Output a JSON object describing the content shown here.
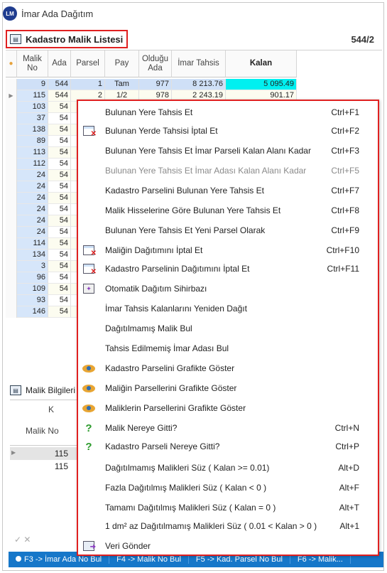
{
  "window": {
    "title": "İmar Ada Dağıtım",
    "logo_text": "LM"
  },
  "panel": {
    "title": "Kadastro Malik Listesi",
    "count": "544/2"
  },
  "grid": {
    "columns": [
      "Malik No",
      "Ada",
      "Parsel",
      "Pay",
      "Olduğu Ada",
      "İmar Tahsis",
      "Kalan"
    ],
    "first_row": {
      "malik_no": "9",
      "ada": "544",
      "parsel": "1",
      "pay": "Tam",
      "oldugu_ada": "977",
      "imar_tahsis": "8 213.76",
      "kalan": "5 095.49"
    },
    "second_row": {
      "malik_no": "115",
      "ada": "544",
      "parsel": "2",
      "pay": "1/2",
      "oldugu_ada": "978",
      "imar_tahsis": "2 243.19",
      "kalan": "901.17"
    },
    "malik_nos": [
      "103",
      "37",
      "138",
      "89",
      "113",
      "112",
      "24",
      "24",
      "24",
      "24",
      "24",
      "24",
      "114",
      "134",
      "3",
      "96",
      "109",
      "93",
      "146"
    ],
    "ada_partial": "54"
  },
  "lower_panel": {
    "title": "Malik Bilgileri",
    "col_k": "K",
    "col_malik_no": "Malik No",
    "rows": [
      "115",
      "115"
    ]
  },
  "statusbar": {
    "items": [
      "F3 -> İmar Ada No Bul",
      "F4 -> Malik No Bul",
      "F5 -> Kad. Parsel No Bul",
      "F6 -> Malik..."
    ]
  },
  "context_menu": {
    "items": [
      {
        "label": "Bulunan Yere Tahsis Et",
        "shortcut": "Ctrl+F1",
        "icon": "none",
        "disabled": false
      },
      {
        "label": "Bulunan Yerde Tahsisi İptal Et",
        "shortcut": "Ctrl+F2",
        "icon": "grid-cancel-icon",
        "disabled": false
      },
      {
        "label": "Bulunan Yere Tahsis Et İmar Parseli Kalan Alanı Kadar",
        "shortcut": "Ctrl+F3",
        "icon": "none",
        "disabled": false
      },
      {
        "label": "Bulunan Yere Tahsis Et İmar Adası Kalan Alanı Kadar",
        "shortcut": "Ctrl+F5",
        "icon": "none",
        "disabled": true
      },
      {
        "label": "Kadastro Parselini Bulunan Yere Tahsis Et",
        "shortcut": "Ctrl+F7",
        "icon": "none",
        "disabled": false
      },
      {
        "label": "Malik Hisselerine Göre Bulunan Yere Tahsis Et",
        "shortcut": "Ctrl+F8",
        "icon": "none",
        "disabled": false
      },
      {
        "label": "Bulunan Yere Tahsis Et Yeni Parsel Olarak",
        "shortcut": "Ctrl+F9",
        "icon": "none",
        "disabled": false
      },
      {
        "label": "Maliğin Dağıtımını İptal Et",
        "shortcut": "Ctrl+F10",
        "icon": "grid-cancel-icon",
        "disabled": false
      },
      {
        "label": "Kadastro Parselinin Dağıtımını İptal Et",
        "shortcut": "Ctrl+F11",
        "icon": "grid-cancel-icon",
        "disabled": false
      },
      {
        "label": "Otomatik Dağıtım Sihirbazı",
        "shortcut": "",
        "icon": "wizard-icon",
        "disabled": false
      },
      {
        "label": "İmar Tahsis Kalanlarını Yeniden Dağıt",
        "shortcut": "",
        "icon": "none",
        "disabled": false
      },
      {
        "label": "Dağıtılmamış Malik Bul",
        "shortcut": "",
        "icon": "none",
        "disabled": false
      },
      {
        "label": "Tahsis Edilmemiş İmar Adası Bul",
        "shortcut": "",
        "icon": "none",
        "disabled": false
      },
      {
        "label": "Kadastro Parselini Grafikte Göster",
        "shortcut": "",
        "icon": "eye-icon",
        "disabled": false
      },
      {
        "label": "Maliğin Parsellerini Grafikte Göster",
        "shortcut": "",
        "icon": "eye-icon",
        "disabled": false
      },
      {
        "label": "Maliklerin Parsellerini Grafikte Göster",
        "shortcut": "",
        "icon": "eye-icon",
        "disabled": false
      },
      {
        "label": "Malik Nereye Gitti?",
        "shortcut": "Ctrl+N",
        "icon": "question-icon",
        "disabled": false
      },
      {
        "label": "Kadastro Parseli Nereye Gitti?",
        "shortcut": "Ctrl+P",
        "icon": "question-icon",
        "disabled": false
      },
      {
        "label": "Dağıtılmamış Malikleri Süz ( Kalan >= 0.01)",
        "shortcut": "Alt+D",
        "icon": "none",
        "disabled": false
      },
      {
        "label": "Fazla Dağıtılmış Malikleri Süz ( Kalan < 0 )",
        "shortcut": "Alt+F",
        "icon": "none",
        "disabled": false
      },
      {
        "label": "Tamamı Dağıtılmış Malikleri Süz ( Kalan = 0 )",
        "shortcut": "Alt+T",
        "icon": "none",
        "disabled": false
      },
      {
        "label": "1 dm² az Dağıtılmamış Malikleri Süz ( 0.01 < Kalan > 0 )",
        "shortcut": "Alt+1",
        "icon": "none",
        "disabled": false
      },
      {
        "label": "Veri Gönder",
        "shortcut": "",
        "icon": "send-icon",
        "disabled": false
      }
    ]
  }
}
